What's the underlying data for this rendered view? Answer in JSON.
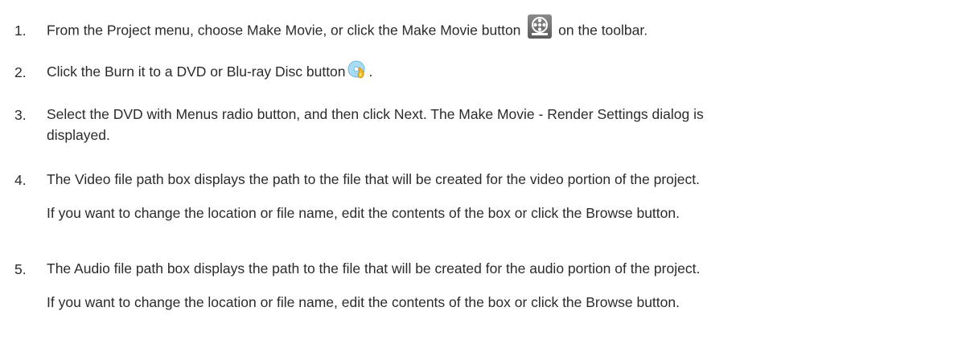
{
  "steps": [
    {
      "number": "1.",
      "text_before": "From the Project menu, choose Make Movie, or click the Make Movie button",
      "icon": "make-movie-film-reel-icon",
      "text_after": "on the toolbar."
    },
    {
      "number": "2.",
      "text_before": "Click the Burn it to a DVD or Blu-ray Disc button",
      "icon": "burn-disc-icon",
      "text_after": "."
    },
    {
      "number": "3.",
      "line1": "Select the DVD with Menus radio button, and then click Next. The Make Movie - Render Settings dialog is",
      "line2": "displayed."
    },
    {
      "number": "4.",
      "line1": "The Video file path box displays the path to the file that will be created for the video portion of the project.",
      "line2": "If you want to change the location or file name, edit the contents of the box or click the Browse button."
    },
    {
      "number": "5.",
      "line1": "The Audio file path box displays the path to the file that will be created for the audio portion of the project.",
      "line2": "If you want to change the location or file name, edit the contents of the box or click the Browse button."
    }
  ],
  "colors": {
    "text": "#2b2b2b",
    "make_movie_icon_bg": "#6e6e6e",
    "burn_icon_disc": "#8fd0f0",
    "burn_icon_flame": "#f2b81c"
  }
}
